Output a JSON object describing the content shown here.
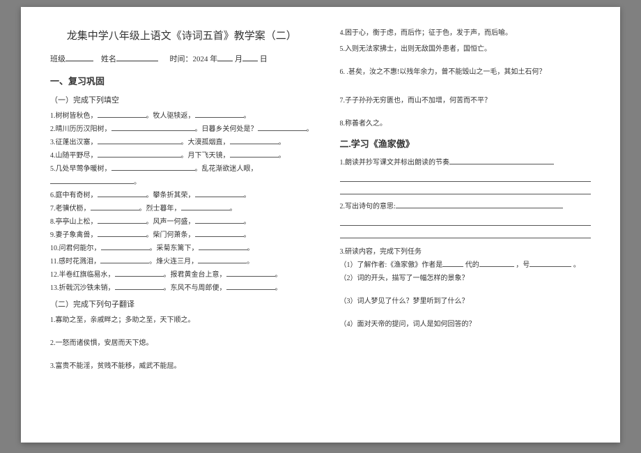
{
  "header": {
    "title": "龙集中学八年级上语文《诗词五首》教学案（二）",
    "class_label": "班级",
    "name_label": "姓名",
    "time_label": "时间：",
    "year": "2024",
    "year_suffix": "年",
    "month_suffix": "月",
    "day_suffix": "日"
  },
  "s1": {
    "heading": "一、复习巩固",
    "sub1": "（一）完成下列填空",
    "items": [
      {
        "a": "1.树树皆秋色，",
        "b": "。牧人驱犊返，",
        "c": "。"
      },
      {
        "a": "2.晴川历历汉阳树，",
        "b": "。日暮乡关何处是？",
        "c": "。"
      },
      {
        "a": "3.征蓬出汉塞，",
        "b": "。大漠孤烟直，",
        "c": "。"
      },
      {
        "a": "4.山随平野尽，",
        "b": "。月下飞天镜，",
        "c": "。"
      },
      {
        "a": "5.几处早莺争暖树，",
        "b": "。乱花渐欲迷人眼，",
        "c": ""
      },
      {
        "a": "",
        "b": "。",
        "c": ""
      },
      {
        "a": "6.庭中有奇树，",
        "b": "。攀条折其荣，",
        "c": "。"
      },
      {
        "a": "7.老骥伏枥，",
        "b": "。烈士暮年，",
        "c": "。"
      },
      {
        "a": "8.亭亭山上松，",
        "b": "。风声一何盛，",
        "c": "。"
      },
      {
        "a": "9.妻子象禽兽，",
        "b": "。柴门何萧条，",
        "c": "。"
      },
      {
        "a": "10.问君何能尔，",
        "b": "。采菊东篱下，",
        "c": "。"
      },
      {
        "a": "11.感时花溅泪，",
        "b": "。烽火连三月，",
        "c": "。"
      },
      {
        "a": "12.半卷红旗临易水，",
        "b": "。报君黄金台上意，",
        "c": "。"
      },
      {
        "a": "13.折戟沉沙铁未销，",
        "b": "。东风不与周郎便，",
        "c": "。"
      }
    ],
    "sub2": "（二）完成下列句子翻译",
    "tr": [
      "1.寡助之至，亲戚畔之；多助之至，天下顺之。",
      "2.一怒而诸侯惧，安居而天下熄。",
      "3.富贵不能淫，贫贱不能移，威武不能屈。"
    ]
  },
  "s2": {
    "tr_cont": [
      "4.困于心，衡于虑，而后作；征于色，发于声，而后喻。",
      "5.入则无法家拂士，出则无敌国外患者，国恒亡。",
      "6. .甚矣，汝之不惠!以残年余力，曾不能毁山之一毛，其如土石何？",
      "7.子子孙孙无穷匮也，而山不加增，何苦而不平？",
      "8.称善者久之。"
    ],
    "heading": "二.学习《渔家傲》",
    "q1": "1.朗读并抄写课文并标出朗读的节奏",
    "q2": "2.写出诗句的意思:",
    "q3": "3.研读内容，完成下列任务",
    "q3_1a": "（1）了解作者:《渔家傲》作者是",
    "q3_1b": "代的",
    "q3_1c": "，号",
    "q3_1d": "。",
    "q3_2": "（2）词的开头，描写了一幅怎样的景象？",
    "q3_3": "（3）词人梦见了什么？梦里听到了什么？",
    "q3_4": "（4）面对天帝的提问，词人是如何回答的？"
  }
}
